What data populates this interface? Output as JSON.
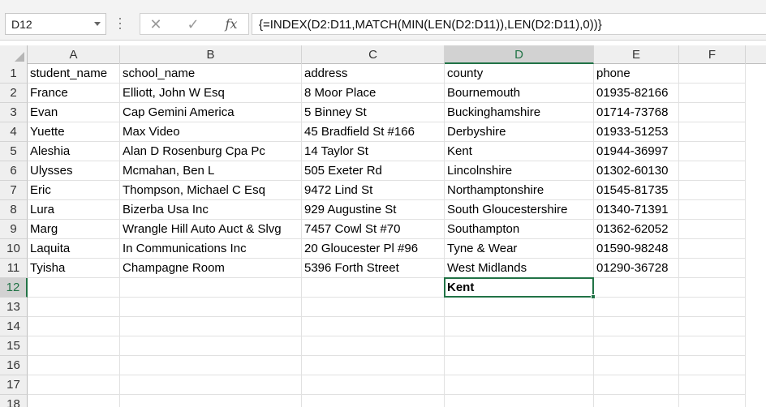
{
  "name_box": {
    "value": "D12"
  },
  "formula_bar": {
    "formula": "{=INDEX(D2:D11,MATCH(MIN(LEN(D2:D11)),LEN(D2:D11),0))}",
    "cancel_icon": "close-icon",
    "enter_icon": "check-icon",
    "function_label": "fx"
  },
  "columns": [
    "A",
    "B",
    "C",
    "D",
    "E",
    "F"
  ],
  "active_column": "D",
  "active_row": "12",
  "row_numbers": [
    "1",
    "2",
    "3",
    "4",
    "5",
    "6",
    "7",
    "8",
    "9",
    "10",
    "11",
    "12",
    "13",
    "14",
    "15",
    "16",
    "17",
    "18"
  ],
  "rows": [
    [
      "student_name",
      "school_name",
      "address",
      "county",
      "phone",
      ""
    ],
    [
      "France",
      "Elliott, John W Esq",
      "8 Moor Place",
      "Bournemouth",
      "01935-82166",
      ""
    ],
    [
      "Evan",
      "Cap Gemini America",
      "5 Binney St",
      "Buckinghamshire",
      "01714-73768",
      ""
    ],
    [
      "Yuette",
      "Max Video",
      "45 Bradfield St #166",
      "Derbyshire",
      "01933-51253",
      ""
    ],
    [
      "Aleshia",
      "Alan D Rosenburg Cpa Pc",
      "14 Taylor St",
      "Kent",
      "01944-36997",
      ""
    ],
    [
      "Ulysses",
      "Mcmahan, Ben L",
      "505 Exeter Rd",
      "Lincolnshire",
      "01302-60130",
      ""
    ],
    [
      "Eric",
      "Thompson, Michael C Esq",
      "9472 Lind St",
      "Northamptonshire",
      "01545-81735",
      ""
    ],
    [
      "Lura",
      "Bizerba Usa Inc",
      "929 Augustine St",
      "South Gloucestershire",
      "01340-71391",
      ""
    ],
    [
      "Marg",
      "Wrangle Hill Auto Auct & Slvg",
      "7457 Cowl St #70",
      "Southampton",
      "01362-62052",
      ""
    ],
    [
      "Laquita",
      "In Communications Inc",
      "20 Gloucester Pl #96",
      "Tyne & Wear",
      "01590-98248",
      ""
    ],
    [
      "Tyisha",
      "Champagne Room",
      "5396 Forth Street",
      "West Midlands",
      "01290-36728",
      ""
    ],
    [
      "",
      "",
      "",
      "Kent",
      "",
      ""
    ],
    [
      "",
      "",
      "",
      "",
      "",
      ""
    ],
    [
      "",
      "",
      "",
      "",
      "",
      ""
    ],
    [
      "",
      "",
      "",
      "",
      "",
      ""
    ],
    [
      "",
      "",
      "",
      "",
      "",
      ""
    ],
    [
      "",
      "",
      "",
      "",
      "",
      ""
    ],
    [
      "",
      "",
      "",
      "",
      "",
      ""
    ]
  ],
  "colors": {
    "accent": "#217346",
    "header_bg": "#efefef",
    "gridline": "#e1e1e1"
  }
}
